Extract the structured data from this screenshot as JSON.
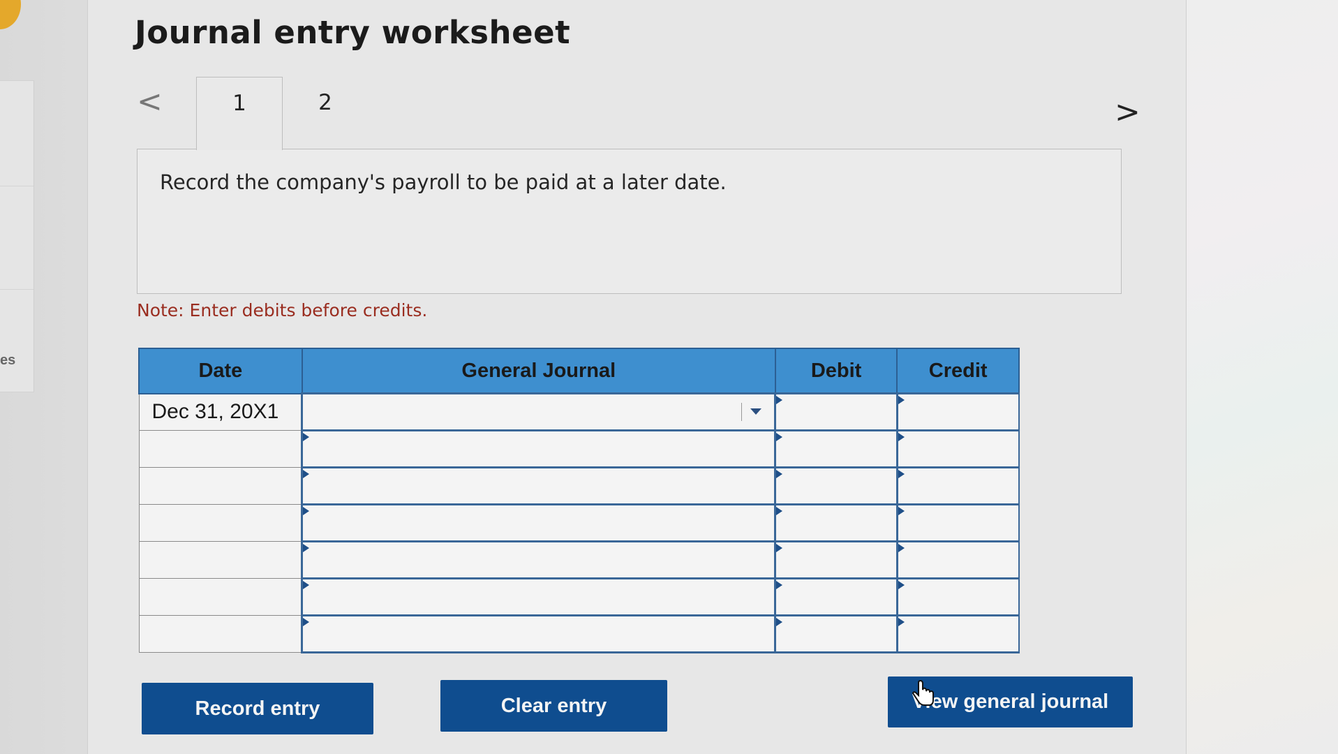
{
  "page": {
    "title": "Journal entry worksheet",
    "side_fragment": "es"
  },
  "tabs": [
    {
      "label": "1",
      "active": true
    },
    {
      "label": "2",
      "active": false
    }
  ],
  "navigation": {
    "prev_icon": "chevron-left-icon",
    "next_icon": "chevron-right-icon"
  },
  "prompt": {
    "text": "Record the company's payroll to be paid at a later date."
  },
  "note": "Note: Enter debits before credits.",
  "journal": {
    "headers": {
      "date": "Date",
      "general_journal": "General Journal",
      "debit": "Debit",
      "credit": "Credit"
    },
    "rows": [
      {
        "date": "Dec 31, 20X1",
        "account": "",
        "debit": "",
        "credit": ""
      },
      {
        "date": "",
        "account": "",
        "debit": "",
        "credit": ""
      },
      {
        "date": "",
        "account": "",
        "debit": "",
        "credit": ""
      },
      {
        "date": "",
        "account": "",
        "debit": "",
        "credit": ""
      },
      {
        "date": "",
        "account": "",
        "debit": "",
        "credit": ""
      },
      {
        "date": "",
        "account": "",
        "debit": "",
        "credit": ""
      },
      {
        "date": "",
        "account": "",
        "debit": "",
        "credit": ""
      }
    ]
  },
  "buttons": {
    "record": "Record entry",
    "clear": "Clear entry",
    "view": "View general journal"
  },
  "colors": {
    "header_blue": "#3e8fcf",
    "button_navy": "#0f4d8f",
    "note_red": "#9a2d20"
  }
}
